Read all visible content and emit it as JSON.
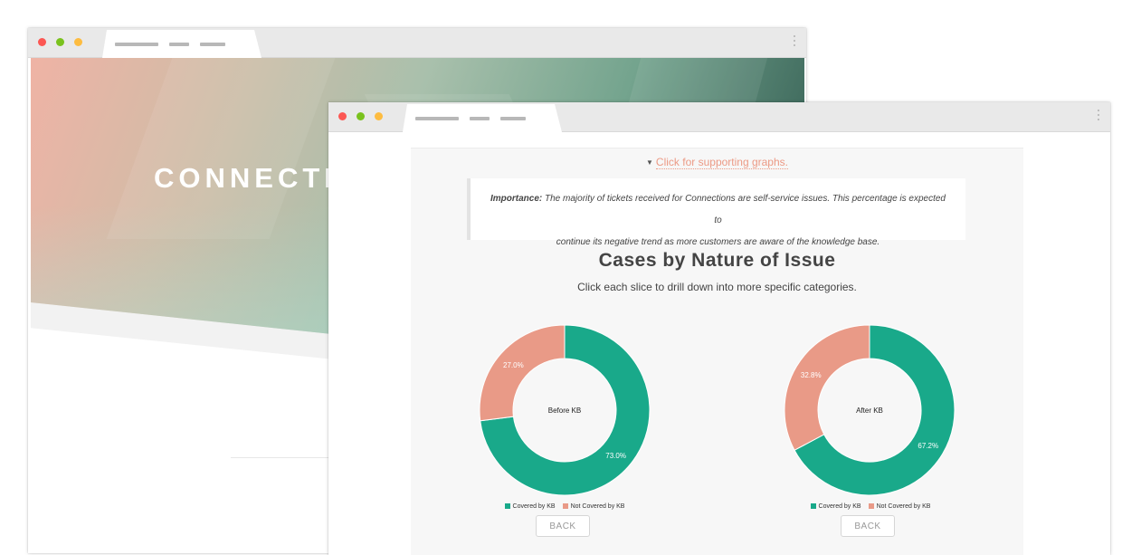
{
  "back_window": {
    "hero_title": "CONNECTIO"
  },
  "front_window": {
    "toggle_link": "Click for supporting graphs.",
    "importance": {
      "label": "Importance:",
      "text_line1": "The majority of tickets received for Connections are self-service issues. This percentage is expected to",
      "text_line2": "continue its negative trend as more customers are aware of the knowledge base."
    },
    "chart_title": "Cases by Nature of Issue",
    "chart_subtitle": "Click each slice to drill down into more specific categories.",
    "back_label": "BACK"
  },
  "colors": {
    "covered": "#19a98a",
    "not_covered": "#e99a87"
  },
  "chart_data": [
    {
      "type": "pie",
      "center_label": "Before KB",
      "categories": [
        "Covered by KB",
        "Not Covered by KB"
      ],
      "values": [
        73.0,
        27.0
      ],
      "labels": [
        "73.0%",
        "27.0%"
      ],
      "legend": [
        "Covered by KB",
        "Not Covered by KB"
      ]
    },
    {
      "type": "pie",
      "center_label": "After KB",
      "categories": [
        "Covered by KB",
        "Not Covered by KB"
      ],
      "values": [
        67.2,
        32.8
      ],
      "labels": [
        "67.2%",
        "32.8%"
      ],
      "legend": [
        "Covered by KB",
        "Not Covered by KB"
      ]
    }
  ]
}
